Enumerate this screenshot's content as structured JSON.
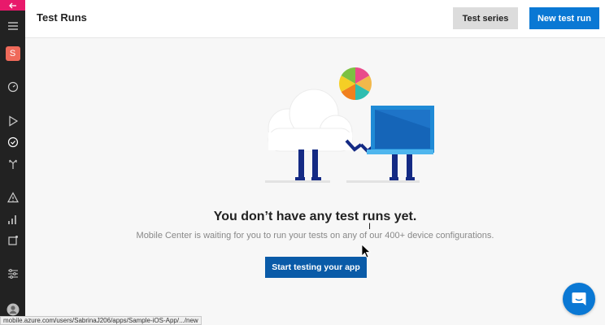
{
  "sidebar": {
    "back_icon": "arrow-left-icon",
    "avatar_letter": "S",
    "items": [
      {
        "name": "hamburger-menu-icon"
      },
      {
        "name": "dashboard-gauge-icon"
      },
      {
        "name": "build-play-icon"
      },
      {
        "name": "test-check-icon"
      },
      {
        "name": "distribute-icon"
      },
      {
        "name": "crashes-warning-icon"
      },
      {
        "name": "analytics-bars-icon"
      },
      {
        "name": "push-icon"
      },
      {
        "name": "settings-sliders-icon"
      },
      {
        "name": "user-profile-icon"
      }
    ]
  },
  "header": {
    "title": "Test Runs",
    "test_series_label": "Test series",
    "new_test_run_label": "New test run"
  },
  "main": {
    "empty_title": "You don’t have any test runs yet.",
    "empty_subtitle": "Mobile Center is waiting for you to run your tests on any of our 400+ device configurations.",
    "start_button_label": "Start testing your app"
  },
  "statusbar": {
    "url": "mobile.azure.com/users/SabrinaJ206/apps/Sample-iOS-App/.../new"
  },
  "colors": {
    "sidebar_bg": "#222222",
    "accent_pink": "#e8196b",
    "primary_blue": "#0a78d4",
    "start_button_blue": "#0a5ba8",
    "avatar_red": "#ef6a5a"
  }
}
